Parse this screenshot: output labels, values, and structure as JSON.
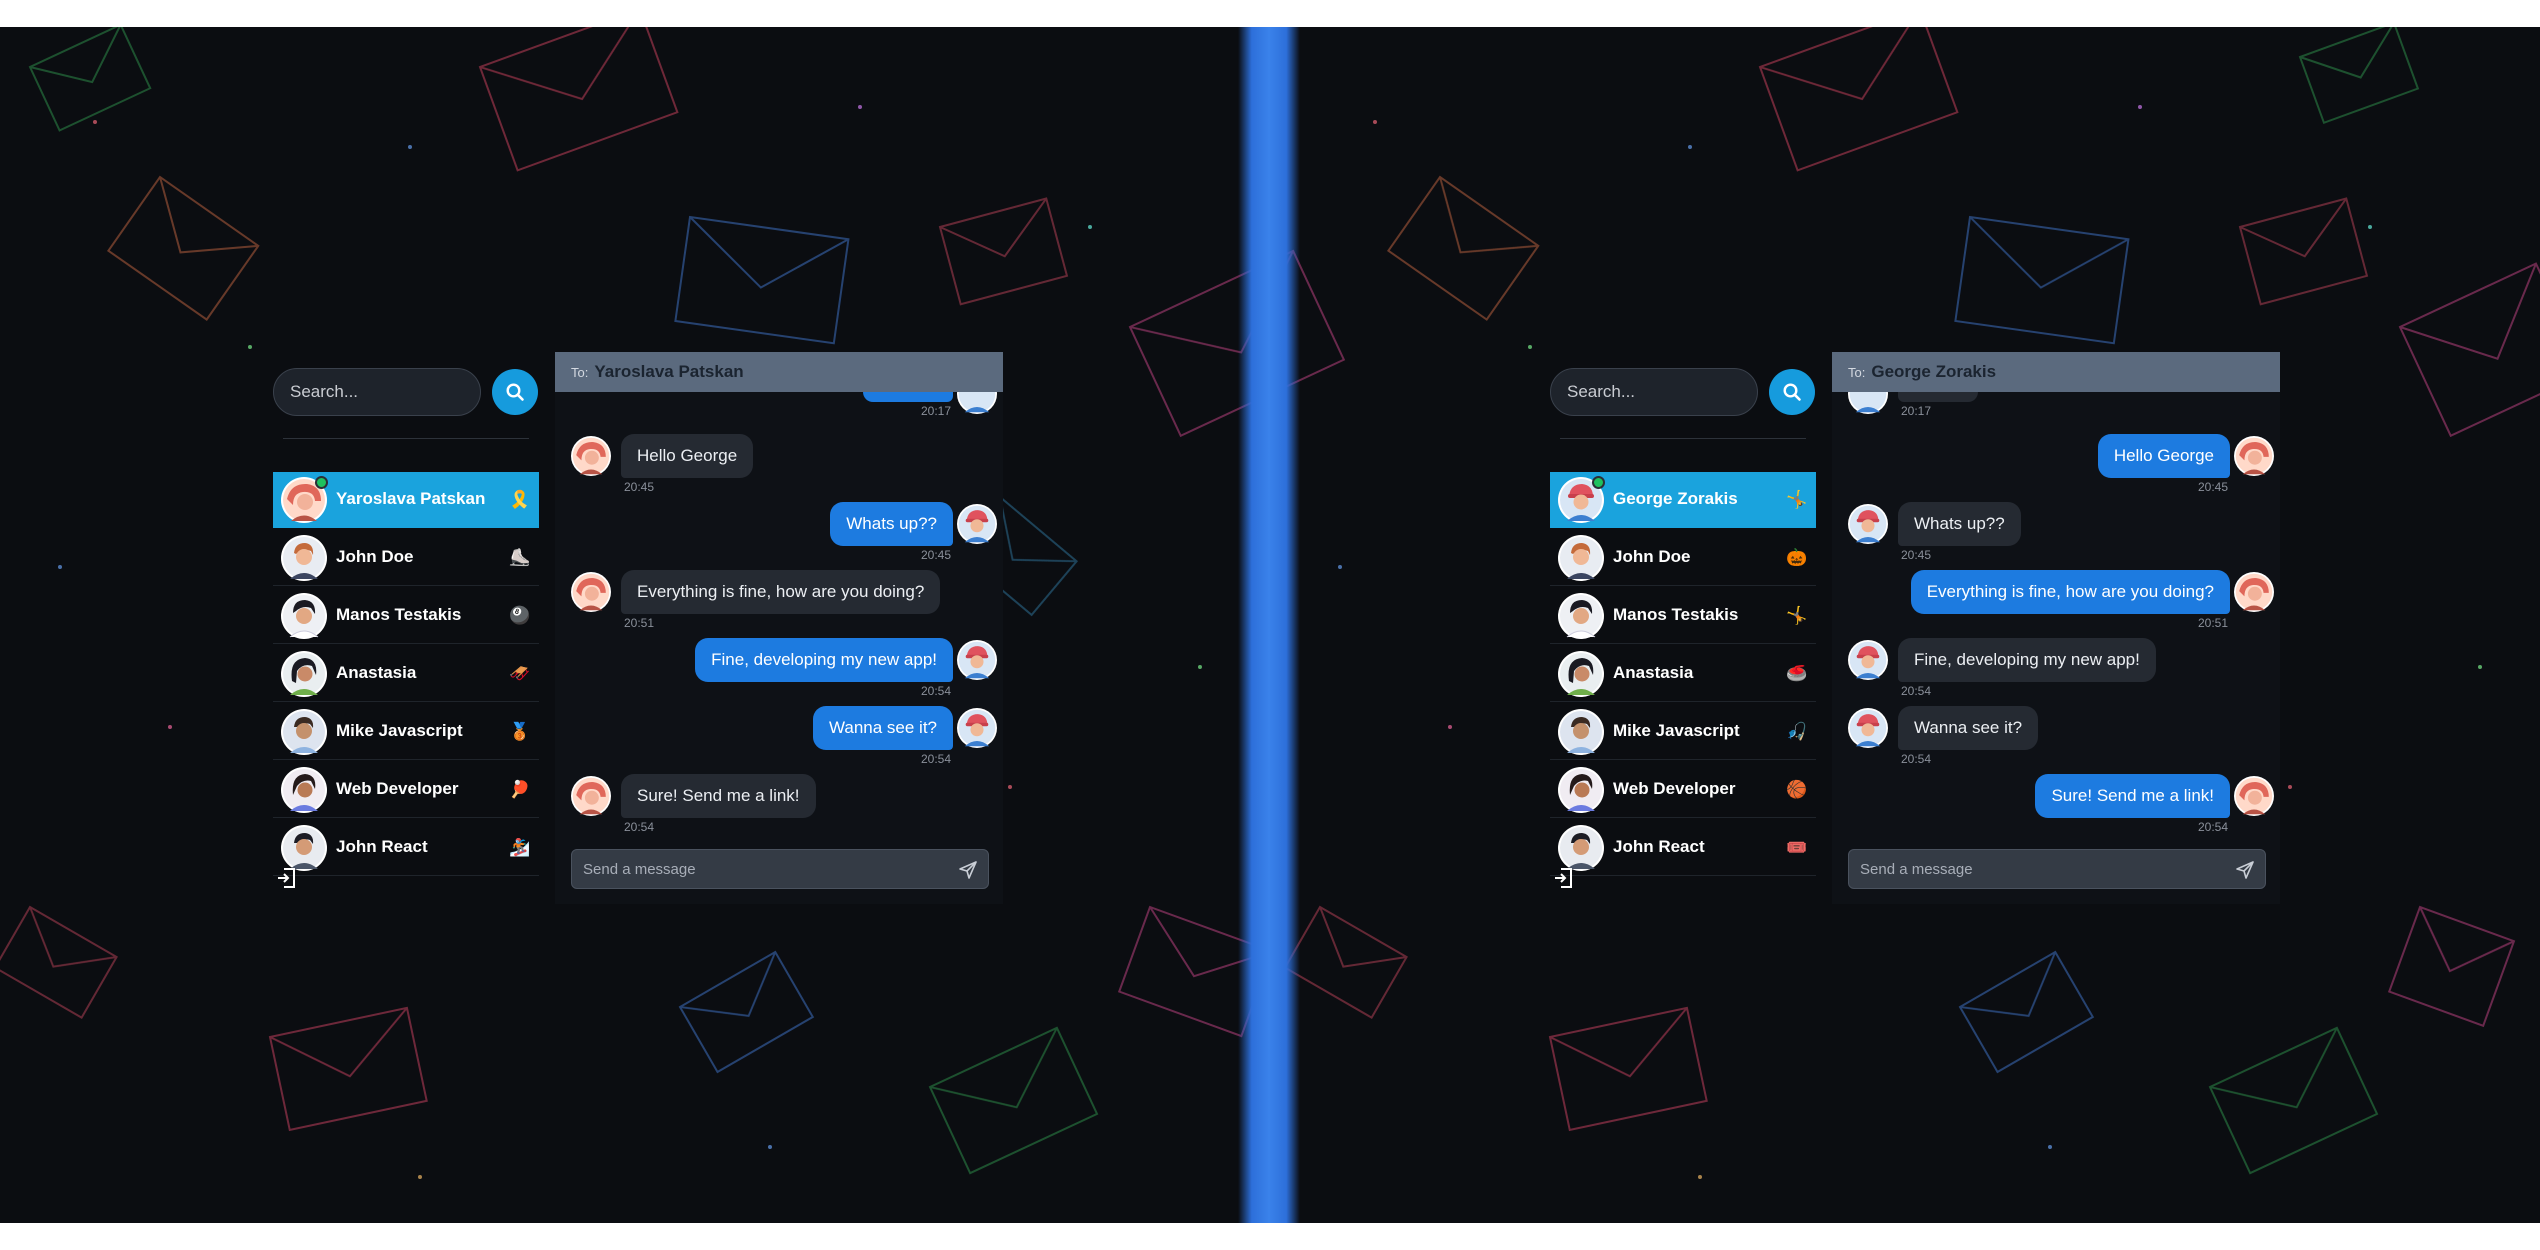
{
  "colors": {
    "background": "#0b0d11",
    "divider": "#2f76e3",
    "active_contact": "#1aa3dd",
    "outgoing_bubble": "#1d7be0",
    "incoming_bubble": "#252a32",
    "chat_header": "#5b6a7e",
    "online": "#1fc15e"
  },
  "left": {
    "search": {
      "placeholder": "Search...",
      "button_icon": "search-icon"
    },
    "contacts": [
      {
        "name": "Yaroslava Patskan",
        "emoji": "🎗️",
        "active": true,
        "online": true,
        "avatar": "woman-red-hair-avatar"
      },
      {
        "name": "John Doe",
        "emoji": "⛸️",
        "avatar": "man-avatar"
      },
      {
        "name": "Manos Testakis",
        "emoji": "🎱",
        "avatar": "man-dark-hair-avatar"
      },
      {
        "name": "Anastasia",
        "emoji": "🛷",
        "avatar": "woman-green-avatar"
      },
      {
        "name": "Mike Javascript",
        "emoji": "🥉",
        "avatar": "man-avatar"
      },
      {
        "name": "Web Developer",
        "emoji": "🏓",
        "avatar": "woman-avatar"
      },
      {
        "name": "John React",
        "emoji": "🏂",
        "avatar": "man-avatar"
      }
    ],
    "logout_icon": "logout-icon",
    "chat": {
      "to_label": "To:",
      "to_name": "Yaroslava Patskan",
      "top_partial_time": "20:17",
      "messages": [
        {
          "dir": "in",
          "text": "Hello George",
          "time": "20:45"
        },
        {
          "dir": "out",
          "text": "Whats up??",
          "time": "20:45"
        },
        {
          "dir": "in",
          "text": "Everything is fine, how are you doing?",
          "time": "20:51"
        },
        {
          "dir": "out",
          "text": "Fine, developing my new app!",
          "time": "20:54"
        },
        {
          "dir": "out",
          "text": "Wanna see it?",
          "time": "20:54"
        },
        {
          "dir": "in",
          "text": "Sure! Send me a link!",
          "time": "20:54"
        }
      ],
      "composer_placeholder": "Send a message",
      "send_icon": "send-icon"
    }
  },
  "right": {
    "search": {
      "placeholder": "Search...",
      "button_icon": "search-icon"
    },
    "contacts": [
      {
        "name": "George Zorakis",
        "emoji": "🤸",
        "active": true,
        "online": true,
        "avatar": "man-red-cap-avatar"
      },
      {
        "name": "John Doe",
        "emoji": "🎃",
        "avatar": "man-avatar"
      },
      {
        "name": "Manos Testakis",
        "emoji": "🤸",
        "avatar": "man-dark-hair-avatar"
      },
      {
        "name": "Anastasia",
        "emoji": "🥌",
        "avatar": "woman-green-avatar"
      },
      {
        "name": "Mike Javascript",
        "emoji": "🎣",
        "avatar": "man-avatar"
      },
      {
        "name": "Web Developer",
        "emoji": "🏀",
        "avatar": "woman-avatar"
      },
      {
        "name": "John React",
        "emoji": "🎟️",
        "avatar": "man-avatar"
      }
    ],
    "logout_icon": "logout-icon",
    "chat": {
      "to_label": "To:",
      "to_name": "George Zorakis",
      "top_partial_time": "20:17",
      "messages": [
        {
          "dir": "out",
          "text": "Hello George",
          "time": "20:45"
        },
        {
          "dir": "in",
          "text": "Whats up??",
          "time": "20:45"
        },
        {
          "dir": "out",
          "text": "Everything is fine, how are you doing?",
          "time": "20:51"
        },
        {
          "dir": "in",
          "text": "Fine, developing my new app!",
          "time": "20:54"
        },
        {
          "dir": "in",
          "text": "Wanna see it?",
          "time": "20:54"
        },
        {
          "dir": "out",
          "text": "Sure! Send me a link!",
          "time": "20:54"
        }
      ],
      "composer_placeholder": "Send a message",
      "send_icon": "send-icon"
    }
  }
}
